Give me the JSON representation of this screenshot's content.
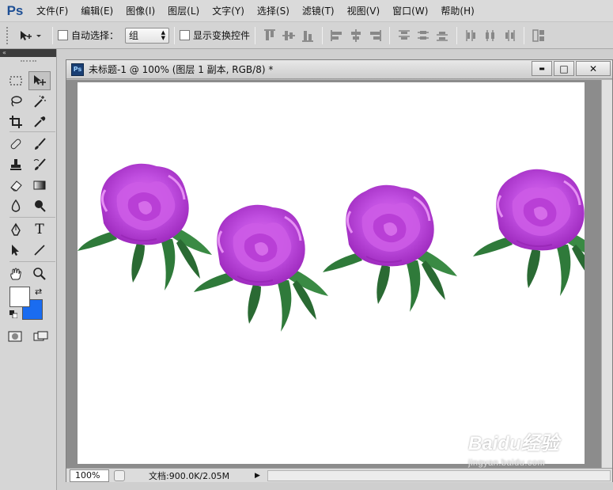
{
  "app": {
    "logo": "Ps",
    "menu": [
      "文件(F)",
      "编辑(E)",
      "图像(I)",
      "图层(L)",
      "文字(Y)",
      "选择(S)",
      "滤镜(T)",
      "视图(V)",
      "窗口(W)",
      "帮助(H)"
    ]
  },
  "options": {
    "auto_select_label": "自动选择：",
    "auto_select_checked": false,
    "auto_select_value": "组",
    "show_transform_label": "显示变换控件",
    "show_transform_checked": false
  },
  "tools_panel": {
    "collapse_label": "«",
    "tools": [
      "rectangular-marquee-icon",
      "move-icon",
      "lasso-icon",
      "magic-wand-icon",
      "crop-icon",
      "eyedropper-icon",
      "healing-brush-icon",
      "brush-icon",
      "clone-stamp-icon",
      "history-brush-icon",
      "eraser-icon",
      "gradient-icon",
      "blur-icon",
      "dodge-icon",
      "pen-icon",
      "type-icon",
      "path-selection-icon",
      "line-icon",
      "hand-icon",
      "zoom-icon"
    ],
    "type_tool_glyph": "T",
    "foreground_color": "#ffffff",
    "background_color": "#1a6cf0"
  },
  "document": {
    "icon_label": "Ps",
    "title": "未标题-1 @ 100% (图层 1 副本, RGB/8) *",
    "zoom": "100%",
    "doc_info": "文档:900.0K/2.05M",
    "canvas_color": "#ffffff",
    "flower_colors": {
      "petal": "#c04ee0",
      "petal_light": "#e070f0",
      "petal_dark": "#a02cc0",
      "leaf": "#2f7a3a"
    }
  },
  "window_buttons": {
    "minimize": "▬",
    "maximize": "□",
    "close": "✕"
  },
  "watermark": {
    "brand": "Baidu经验",
    "url": "jingyan.baidu.com"
  }
}
